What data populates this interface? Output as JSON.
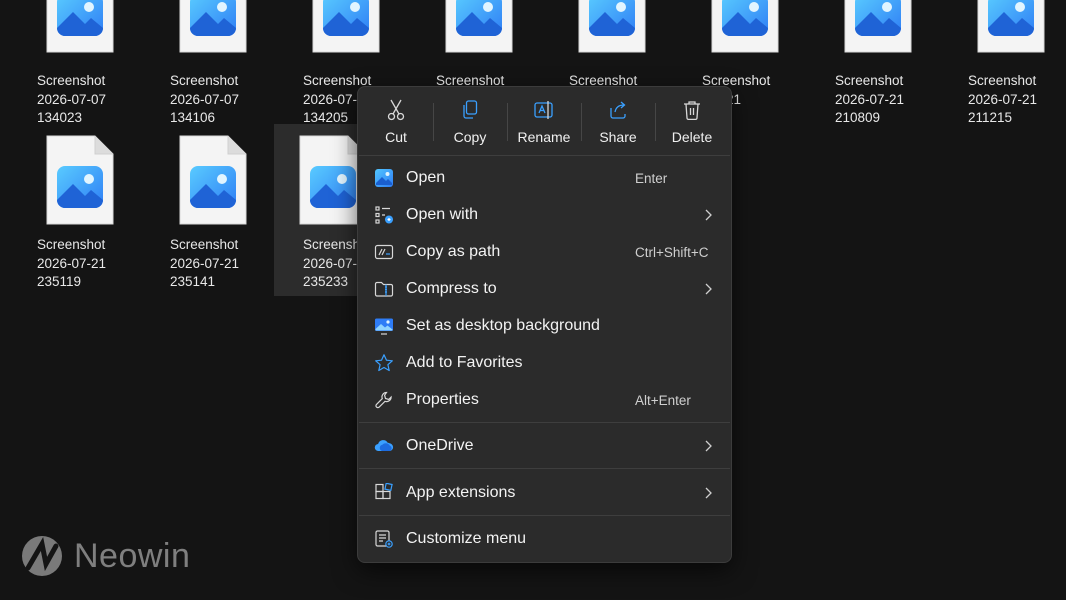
{
  "files": [
    {
      "line1": "Screenshot",
      "line2": "2026-07-07",
      "line3": "134023"
    },
    {
      "line1": "Screenshot",
      "line2": "2026-07-07",
      "line3": "134106"
    },
    {
      "line1": "Screenshot",
      "line2": "2026-07-",
      "line3": "134205"
    },
    {
      "line1": "Screenshot",
      "line2": "",
      "line3": ""
    },
    {
      "line1": "Screenshot",
      "line2": "",
      "line3": ""
    },
    {
      "line1": "Screenshot",
      "line2": "-07-21",
      "line3": "01"
    },
    {
      "line1": "Screenshot",
      "line2": "2026-07-21",
      "line3": "210809"
    },
    {
      "line1": "Screenshot",
      "line2": "2026-07-21",
      "line3": "211215"
    },
    {
      "line1": "Screenshot",
      "line2": "2026-07-21",
      "line3": "235119"
    },
    {
      "line1": "Screenshot",
      "line2": "2026-07-21",
      "line3": "235141"
    },
    {
      "line1": "Screensh",
      "line2": "2026-07-",
      "line3": "235233"
    }
  ],
  "context_menu": {
    "quick_actions": [
      {
        "label": "Cut",
        "icon": "cut-icon"
      },
      {
        "label": "Copy",
        "icon": "copy-icon"
      },
      {
        "label": "Rename",
        "icon": "rename-icon"
      },
      {
        "label": "Share",
        "icon": "share-icon"
      },
      {
        "label": "Delete",
        "icon": "delete-icon"
      }
    ],
    "items": [
      {
        "label": "Open",
        "shortcut": "Enter",
        "icon": "photos-icon"
      },
      {
        "label": "Open with",
        "shortcut": "",
        "icon": "open-with-icon",
        "submenu": true
      },
      {
        "label": "Copy as path",
        "shortcut": "Ctrl+Shift+C",
        "icon": "copy-path-icon"
      },
      {
        "label": "Compress to",
        "shortcut": "",
        "icon": "compress-icon",
        "submenu": true
      },
      {
        "label": "Set as desktop background",
        "shortcut": "",
        "icon": "desktop-background-icon"
      },
      {
        "label": "Add to Favorites",
        "shortcut": "",
        "icon": "star-icon"
      },
      {
        "label": "Properties",
        "shortcut": "Alt+Enter",
        "icon": "wrench-icon"
      },
      {
        "label": "OneDrive",
        "shortcut": "",
        "icon": "onedrive-icon",
        "submenu": true
      },
      {
        "label": "App extensions",
        "shortcut": "",
        "icon": "app-extensions-icon",
        "submenu": true
      },
      {
        "label": "Customize menu",
        "shortcut": "",
        "icon": "customize-icon"
      }
    ]
  },
  "watermark": {
    "text": "Neowin"
  },
  "colors": {
    "background": "#141414",
    "menu": "#2b2b2b",
    "accent": "#3aa0ff"
  }
}
